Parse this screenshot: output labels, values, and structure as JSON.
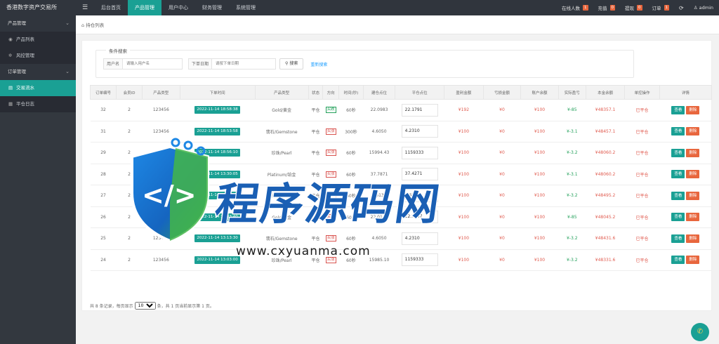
{
  "header": {
    "brand": "香港数字资产交易所",
    "menu_toggle_icon": "menu-icon",
    "nav": [
      {
        "label": "后台首页",
        "active": false
      },
      {
        "label": "产品管理",
        "active": true
      },
      {
        "label": "用户中心",
        "active": false
      },
      {
        "label": "财务管理",
        "active": false
      },
      {
        "label": "系统管理",
        "active": false
      }
    ],
    "right": [
      {
        "label": "在线人数",
        "badge": "1"
      },
      {
        "label": "充值",
        "badge": "0"
      },
      {
        "label": "提现",
        "badge": "0"
      },
      {
        "label": "订单",
        "badge": "1"
      }
    ],
    "refresh_icon": "refresh-icon",
    "user_label": "admin"
  },
  "sidebar": {
    "groups": [
      {
        "label": "产品管理",
        "items": [
          {
            "label": "产品列表",
            "icon": "layers-icon",
            "active": false
          },
          {
            "label": "风控管理",
            "icon": "gear-icon",
            "active": false
          }
        ]
      },
      {
        "label": "订单管理",
        "items": [
          {
            "label": "交易流水",
            "icon": "list-icon",
            "active": true
          },
          {
            "label": "平仓日志",
            "icon": "doc-icon",
            "active": false
          }
        ]
      }
    ]
  },
  "tab": {
    "label": "持仓列表"
  },
  "search": {
    "legend": "条件搜索",
    "user_label": "用户名",
    "user_placeholder": "请输入用户名",
    "time_label": "下单日期",
    "time_placeholder": "请按下单日期",
    "search_label": "搜索",
    "reset_label": "重新搜索"
  },
  "table": {
    "headers": [
      "订单编号",
      "会员ID",
      "产品类型",
      "下单时间",
      "产品类型",
      "状态",
      "方向",
      "时间(秒)",
      "建仓点位",
      "平仓点位",
      "盈利金额",
      "亏损金额",
      "账户余额",
      "实际盈亏",
      "本金余额",
      "单控操作",
      "详情"
    ],
    "rows": [
      {
        "id": "32",
        "uid": "2",
        "code": "123456",
        "time": "2022-11-14 18:58:38",
        "product": "Gold/黄金",
        "status": "平仓",
        "dir": "买跌",
        "dir_type": "buy",
        "sec": "60秒",
        "open": "22.0983",
        "close": "22.1791",
        "profit": "¥192",
        "loss": "¥0",
        "balance": "¥100",
        "pl": "¥-85",
        "capital": "¥48357.1",
        "op": "已平仓",
        "view": "查看",
        "del": "删除"
      },
      {
        "id": "31",
        "uid": "2",
        "code": "123456",
        "time": "2022-11-14 18:53:58",
        "product": "翡石/Gemstone",
        "status": "平仓",
        "dir": "买涨",
        "dir_type": "sell",
        "sec": "300秒",
        "open": "4.6050",
        "close": "4.2310",
        "profit": "¥100",
        "loss": "¥0",
        "balance": "¥100",
        "pl": "¥-3.1",
        "capital": "¥48457.1",
        "op": "已平仓",
        "view": "查看",
        "del": "删除"
      },
      {
        "id": "29",
        "uid": "2",
        "code": "123456",
        "time": "2022-11-14 18:56:10",
        "product": "珍珠/Pearl",
        "status": "平仓",
        "dir": "买涨",
        "dir_type": "sell",
        "sec": "60秒",
        "open": "15994.43",
        "close": "1159333",
        "profit": "¥100",
        "loss": "¥0",
        "balance": "¥100",
        "pl": "¥-3.2",
        "capital": "¥48060.2",
        "op": "已平仓",
        "view": "查看",
        "del": "删除"
      },
      {
        "id": "28",
        "uid": "2",
        "code": "123456",
        "time": "2022-11-14 13:30:05",
        "product": "Platinum/铂金",
        "status": "平仓",
        "dir": "买涨",
        "dir_type": "sell",
        "sec": "60秒",
        "open": "37.7871",
        "close": "37.4271",
        "profit": "¥100",
        "loss": "¥0",
        "balance": "¥100",
        "pl": "¥-3.1",
        "capital": "¥48060.2",
        "op": "已平仓",
        "view": "查看",
        "del": "删除"
      },
      {
        "id": "27",
        "uid": "2",
        "code": "123456",
        "time": "2022-11-14 13:23:00",
        "product": "Silver/白银",
        "status": "平仓",
        "dir": "买涨",
        "dir_type": "sell",
        "sec": "60秒",
        "open": "0.6139",
        "close": "1.6330",
        "profit": "¥100",
        "loss": "¥0",
        "balance": "¥100",
        "pl": "¥-3.2",
        "capital": "¥48495.2",
        "op": "已平仓",
        "view": "查看",
        "del": "删除"
      },
      {
        "id": "26",
        "uid": "2",
        "code": "123456",
        "time": "2022-11-14 13:03:40",
        "product": "Gold/黄金",
        "status": "平仓",
        "dir": "买涨",
        "dir_type": "sell",
        "sec": "60秒",
        "open": "22.0147",
        "close": "22.7747",
        "profit": "¥100",
        "loss": "¥0",
        "balance": "¥100",
        "pl": "¥-85",
        "capital": "¥48045.2",
        "op": "已平仓",
        "view": "查看",
        "del": "删除"
      },
      {
        "id": "25",
        "uid": "2",
        "code": "123456",
        "time": "2022-11-14 13:13:30",
        "product": "翡石/Gemstone",
        "status": "平仓",
        "dir": "买涨",
        "dir_type": "sell",
        "sec": "60秒",
        "open": "4.6050",
        "close": "4.2310",
        "profit": "¥100",
        "loss": "¥0",
        "balance": "¥100",
        "pl": "¥-3.2",
        "capital": "¥48431.6",
        "op": "已平仓",
        "view": "查看",
        "del": "删除"
      },
      {
        "id": "24",
        "uid": "2",
        "code": "123456",
        "time": "2022-11-14 13:03:00",
        "product": "珍珠/Pearl",
        "status": "平仓",
        "dir": "买涨",
        "dir_type": "sell",
        "sec": "60秒",
        "open": "15985.10",
        "close": "1159333",
        "profit": "¥100",
        "loss": "¥0",
        "balance": "¥100",
        "pl": "¥-3.2",
        "capital": "¥48331.6",
        "op": "已平仓",
        "view": "查看",
        "del": "删除"
      }
    ]
  },
  "pager": {
    "prefix": "共 8 条记录，每页显示",
    "page_size": "10",
    "suffix": "条，共 1 页当前显示第 1 页。"
  },
  "watermark": {
    "text": "程序源码网",
    "url": "www.cxyuanma.com",
    "logo_glyph": "</>"
  },
  "colors": {
    "accent": "#1aa094",
    "danger": "#e8663d",
    "topbar": "#30353d",
    "watermark_blue": "#1a5fb4"
  }
}
